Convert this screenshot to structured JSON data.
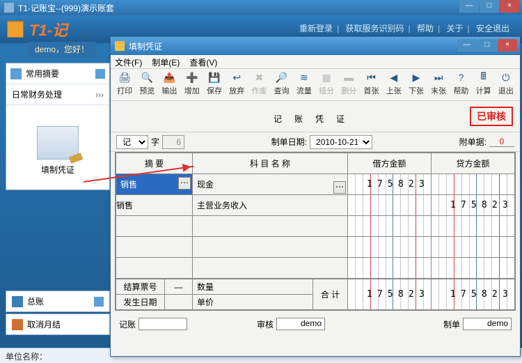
{
  "outer": {
    "title": "T1-记账宝--(999)演示账套",
    "min": "—",
    "max": "□",
    "close": "×"
  },
  "app": {
    "logo": "T1-记",
    "links": [
      "重新登录",
      "获取服务识别码",
      "帮助",
      "关于",
      "安全退出"
    ],
    "sep": "|",
    "greet": "demo，您好！"
  },
  "left": {
    "header": "常用摘要",
    "section": "日常财务处理",
    "arrow": "›››",
    "bigicon": "填制凭证",
    "bottom": [
      {
        "icon": "book",
        "label": "总账"
      },
      {
        "icon": "cancel",
        "label": "取消月结"
      }
    ]
  },
  "status": {
    "label": "单位名称："
  },
  "inner": {
    "title": "填制凭证",
    "menus": [
      "文件(F)",
      "制单(E)",
      "查看(V)"
    ],
    "toolbar": [
      {
        "i": "🖨",
        "l": "打印"
      },
      {
        "i": "🔍",
        "l": "预览"
      },
      {
        "i": "📤",
        "l": "输出"
      },
      {
        "i": "➕",
        "l": "增加"
      },
      {
        "i": "💾",
        "l": "保存"
      },
      {
        "i": "↩",
        "l": "放弃"
      },
      {
        "i": "✖",
        "l": "作废",
        "dis": true
      },
      {
        "i": "🔎",
        "l": "查询"
      },
      {
        "i": "≋",
        "l": "流量"
      },
      {
        "i": "▦",
        "l": "插分",
        "dis": true
      },
      {
        "i": "▬",
        "l": "删分",
        "dis": true
      },
      {
        "i": "⏮",
        "l": "首张"
      },
      {
        "i": "◀",
        "l": "上张"
      },
      {
        "i": "▶",
        "l": "下张"
      },
      {
        "i": "⏭",
        "l": "末张"
      },
      {
        "i": "?",
        "l": "帮助"
      },
      {
        "i": "🖩",
        "l": "计算"
      },
      {
        "i": "⏻",
        "l": "退出"
      }
    ],
    "doc_title": "记账凭证",
    "stamp": "已审核",
    "ctrl": {
      "type_label": "记",
      "zi": "字",
      "seq": "6",
      "date_label": "制单日期:",
      "date": "2010-10-21",
      "attach_label": "附单据:",
      "attach": "0"
    },
    "cols": [
      "摘  要",
      "科 目 名 称",
      "借方金额",
      "贷方金额"
    ],
    "rows": [
      {
        "summary": "销售",
        "sel": true,
        "subject": "现金",
        "subj_dots": true,
        "debit": "175823",
        "credit": ""
      },
      {
        "summary": "销售",
        "subject": "主营业务收入",
        "debit": "",
        "credit": "175823"
      },
      {
        "summary": "",
        "subject": "",
        "debit": "",
        "credit": ""
      },
      {
        "summary": "",
        "subject": "",
        "debit": "",
        "credit": ""
      },
      {
        "summary": "",
        "subject": "",
        "debit": "",
        "credit": ""
      }
    ],
    "foot": {
      "l1a": "结算票号",
      "l1b": "—",
      "l1c": "数量",
      "l2a": "发生日期",
      "l2c": "单价",
      "total": "合  计",
      "debit": "175823",
      "credit": "175823"
    },
    "sign": [
      {
        "l": "记账",
        "v": ""
      },
      {
        "l": "审核",
        "v": "demo"
      },
      {
        "l": "制单",
        "v": "demo"
      }
    ]
  }
}
